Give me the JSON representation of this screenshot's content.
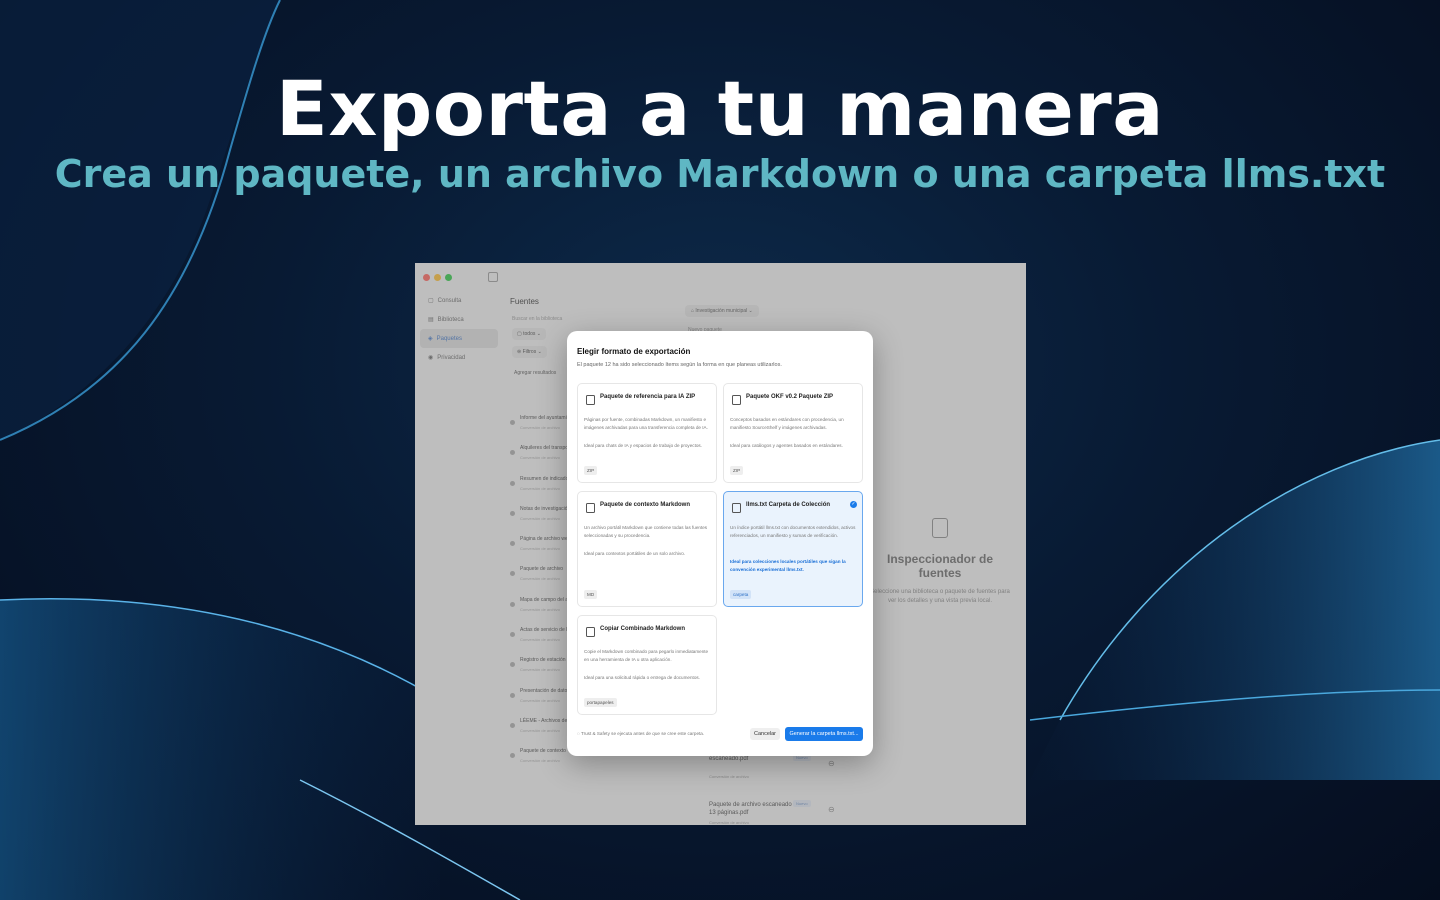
{
  "hero": {
    "title": "Exporta a tu manera",
    "subtitle": "Crea un paquete, un archivo Markdown o una carpeta llms.txt"
  },
  "colors": {
    "accent": "#1a7bea",
    "subtitle": "#5fb7c4",
    "selected_bg": "#eaf3fd"
  },
  "window": {
    "sidebar": [
      {
        "label": "Consulta",
        "icon": "doc-icon"
      },
      {
        "label": "Biblioteca",
        "icon": "library-icon"
      },
      {
        "label": "Paquetes",
        "icon": "package-icon"
      },
      {
        "label": "Privacidad",
        "icon": "shield-icon"
      }
    ],
    "middle": {
      "title": "Fuentes",
      "search_placeholder": "Buscar en la biblioteca",
      "filter_all": "todos",
      "filter_label": "Filtros",
      "add_results": "Agregar resultados"
    },
    "sources": [
      {
        "name": "Informe del ayuntamiento",
        "sub": "Conversión de archivo"
      },
      {
        "name": "Alquileres del transporte",
        "sub": "Conversión de archivo"
      },
      {
        "name": "Resumen de indicadores",
        "sub": "Conversión de archivo"
      },
      {
        "name": "Notas de investigación",
        "sub": "Conversión de archivo"
      },
      {
        "name": "Página de archivo web",
        "sub": "Conversión de archivo"
      },
      {
        "name": "Paquete de archivo",
        "sub": "Conversión de archivo"
      },
      {
        "name": "Mapa de campo del archivo",
        "sub": "Conversión de archivo"
      },
      {
        "name": "Actas de servicio de la",
        "sub": "Conversión de archivo"
      },
      {
        "name": "Registro de estación",
        "sub": "Conversión de archivo"
      },
      {
        "name": "Presentación de datos",
        "sub": "Conversión de archivo"
      },
      {
        "name": "LÉEME - Archivos de",
        "sub": "Conversión de archivo"
      },
      {
        "name": "Paquete de contexto",
        "sub": "Conversión de archivo"
      }
    ],
    "collection": "Investigación municipal",
    "collection_sub": "Nuevo paquete",
    "bottom_cards": [
      {
        "title": "escaneado.pdf",
        "sub": "Conversión de archivo",
        "badge": "Nuevo"
      },
      {
        "title": "Paquete de archivo escaneado - 13 páginas.pdf",
        "sub": "Conversión de archivo",
        "badge": "Nuevo"
      }
    ],
    "inspector": {
      "title": "Inspeccionador de fuentes",
      "subtitle": "Seleccione una biblioteca o paquete de fuentes para ver los detalles y una vista previa local."
    }
  },
  "dialog": {
    "title": "Elegir formato de exportación",
    "subtitle": "El paquete 12 ha sido seleccionado ítems según la forma en que planeas utilizarlos.",
    "options": [
      {
        "title": "Paquete de referencia para IA ZIP",
        "desc": "Páginas por fuente, combinadas Markdown, un manifiesto e imágenes archivadas para una transferencia completa de IA.",
        "ideal": "Ideal para chats de IA y espacios de trabajo de proyectos.",
        "tag": "ZIP",
        "icon": "package-icon",
        "selected": false
      },
      {
        "title": "Paquete OKF v0.2 Paquete ZIP",
        "desc": "Conceptos basados en estándares con procedencia, un manifiesto SourceShelf y imágenes archivadas.",
        "ideal": "Ideal para catálogos y agentes basados en estándares.",
        "tag": "ZIP",
        "icon": "cube-icon",
        "selected": false
      },
      {
        "title": "Paquete de contexto Markdown",
        "desc": "Un archivo portátil Markdown que contiene todas las fuentes seleccionadas y su procedencia.",
        "ideal": "Ideal para contextos portátiles de un solo archivo.",
        "tag": "MD",
        "icon": "document-icon",
        "selected": false
      },
      {
        "title": "llms.txt Carpeta de Colección",
        "desc": "Un índice portátil llms.txt con documentos extendidos, activos referenciados, un manifiesto y sumas de verificación.",
        "ideal": "Ideal para colecciones locales portátiles que sigan la convención experimental llms.txt.",
        "tag": "carpeta",
        "icon": "folder-icon",
        "selected": true
      },
      {
        "title": "Copiar Combinado Markdown",
        "desc": "Copie el Markdown combinado para pegarlo inmediatamente en una herramienta de IA u otra aplicación.",
        "ideal": "Ideal para una solicitud rápida o entrega de documentos.",
        "tag": "portapapeles",
        "icon": "clipboard-icon",
        "selected": false
      }
    ],
    "footer_note": "Trust & Safety se ejecuta antes de que se cree este carpeta.",
    "cancel_label": "Cancelar",
    "generate_label": "Generar la carpeta llms.txt..."
  }
}
